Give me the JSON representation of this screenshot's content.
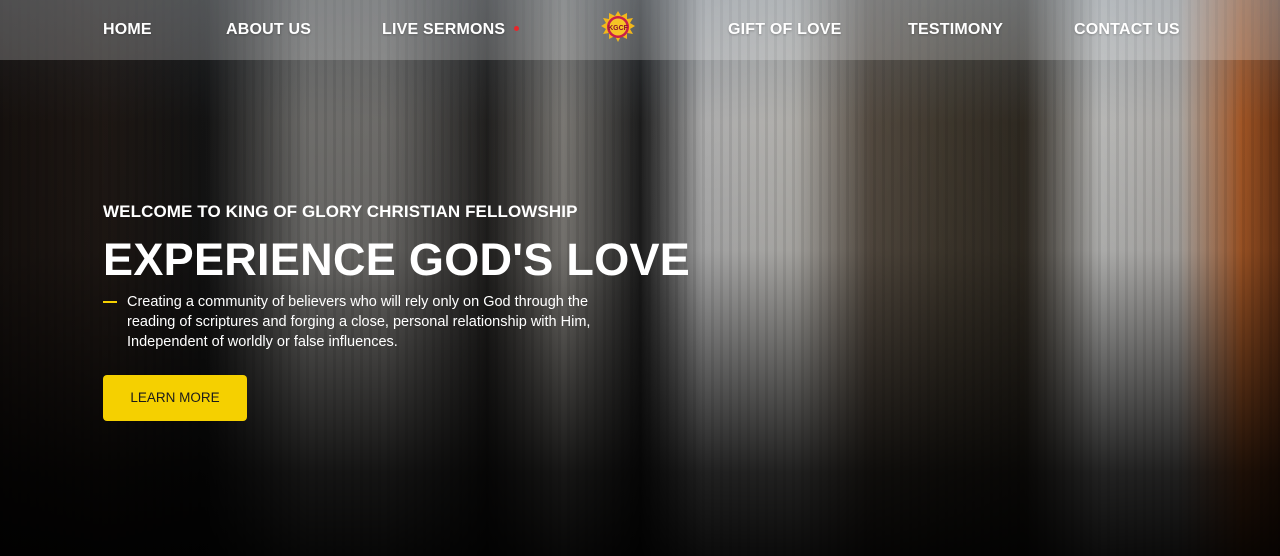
{
  "nav": {
    "home": "HOME",
    "about": "ABOUT US",
    "live_sermons": "LIVE SERMONS",
    "logo_text": "KGCF",
    "gift": "GIFT OF LOVE",
    "testimony": "TESTIMONY",
    "contact": "CONTACT US"
  },
  "hero": {
    "kicker": "WELCOME TO KING OF GLORY CHRISTIAN FELLOWSHIP",
    "title": "EXPERIENCE GOD'S LOVE",
    "description": "Creating a community of believers who will rely only on God through the reading of scriptures and forging a close, personal relationship with Him, Independent of worldly or false influences.",
    "cta_label": "LEARN MORE"
  },
  "colors": {
    "accent": "#f5d000",
    "live_dot": "#e8262a"
  },
  "icons": {
    "logo": "church-crest-logo",
    "live_indicator": "live-dot-icon"
  }
}
